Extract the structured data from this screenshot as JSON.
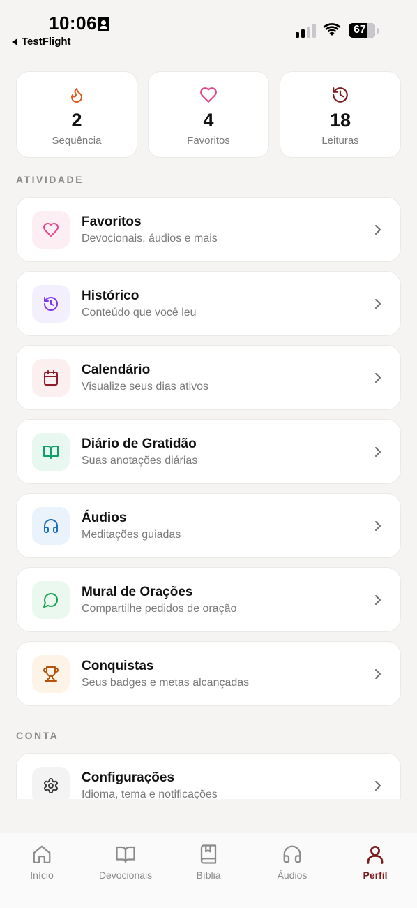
{
  "status_bar": {
    "time": "10:06",
    "back_app": "TestFlight",
    "battery": "67"
  },
  "stats": [
    {
      "icon": "flame-icon",
      "value": "2",
      "label": "Sequência",
      "color": "#e2571c"
    },
    {
      "icon": "heart-icon",
      "value": "4",
      "label": "Favoritos",
      "color": "#e0488c"
    },
    {
      "icon": "history-icon",
      "value": "18",
      "label": "Leituras",
      "color": "#7b1d1d"
    }
  ],
  "sections": {
    "activity": "ATIVIDADE",
    "account": "CONTA"
  },
  "activity_items": [
    {
      "icon": "heart-icon",
      "title": "Favoritos",
      "subtitle": "Devocionais, áudios e mais",
      "color": "#e0488c",
      "bg": "#fdeef4"
    },
    {
      "icon": "history-icon",
      "title": "Histórico",
      "subtitle": "Conteúdo que você leu",
      "color": "#7c3aed",
      "bg": "#f3effd"
    },
    {
      "icon": "calendar-icon",
      "title": "Calendário",
      "subtitle": "Visualize seus dias ativos",
      "color": "#8b1d2c",
      "bg": "#fcefef"
    },
    {
      "icon": "book-open-icon",
      "title": "Diário de Gratidão",
      "subtitle": "Suas anotações diárias",
      "color": "#0e9f6e",
      "bg": "#e8f7ef"
    },
    {
      "icon": "headphones-icon",
      "title": "Áudios",
      "subtitle": "Meditações guiadas",
      "color": "#1d6fb8",
      "bg": "#eaf3fc"
    },
    {
      "icon": "message-circle-icon",
      "title": "Mural de Orações",
      "subtitle": "Compartilhe pedidos de oração",
      "color": "#16a34a",
      "bg": "#eaf8ef"
    },
    {
      "icon": "trophy-icon",
      "title": "Conquistas",
      "subtitle": "Seus badges e metas alcançadas",
      "color": "#b45309",
      "bg": "#fdf3e6"
    }
  ],
  "account_items": [
    {
      "icon": "gear-icon",
      "title": "Configurações",
      "subtitle": "Idioma, tema e notificações",
      "color": "#3a3a3a",
      "bg": "#f3f3f4"
    }
  ],
  "tabs": [
    {
      "icon": "home-icon",
      "label": "Início"
    },
    {
      "icon": "book-open-icon",
      "label": "Devocionais"
    },
    {
      "icon": "bible-icon",
      "label": "Bíblia"
    },
    {
      "icon": "headphones-icon",
      "label": "Áudios"
    },
    {
      "icon": "user-icon",
      "label": "Perfil",
      "active": true
    }
  ],
  "colors": {
    "accent": "#7b1d1d",
    "inactive_tab": "#8a8a8a",
    "background": "#f5f4f2"
  }
}
